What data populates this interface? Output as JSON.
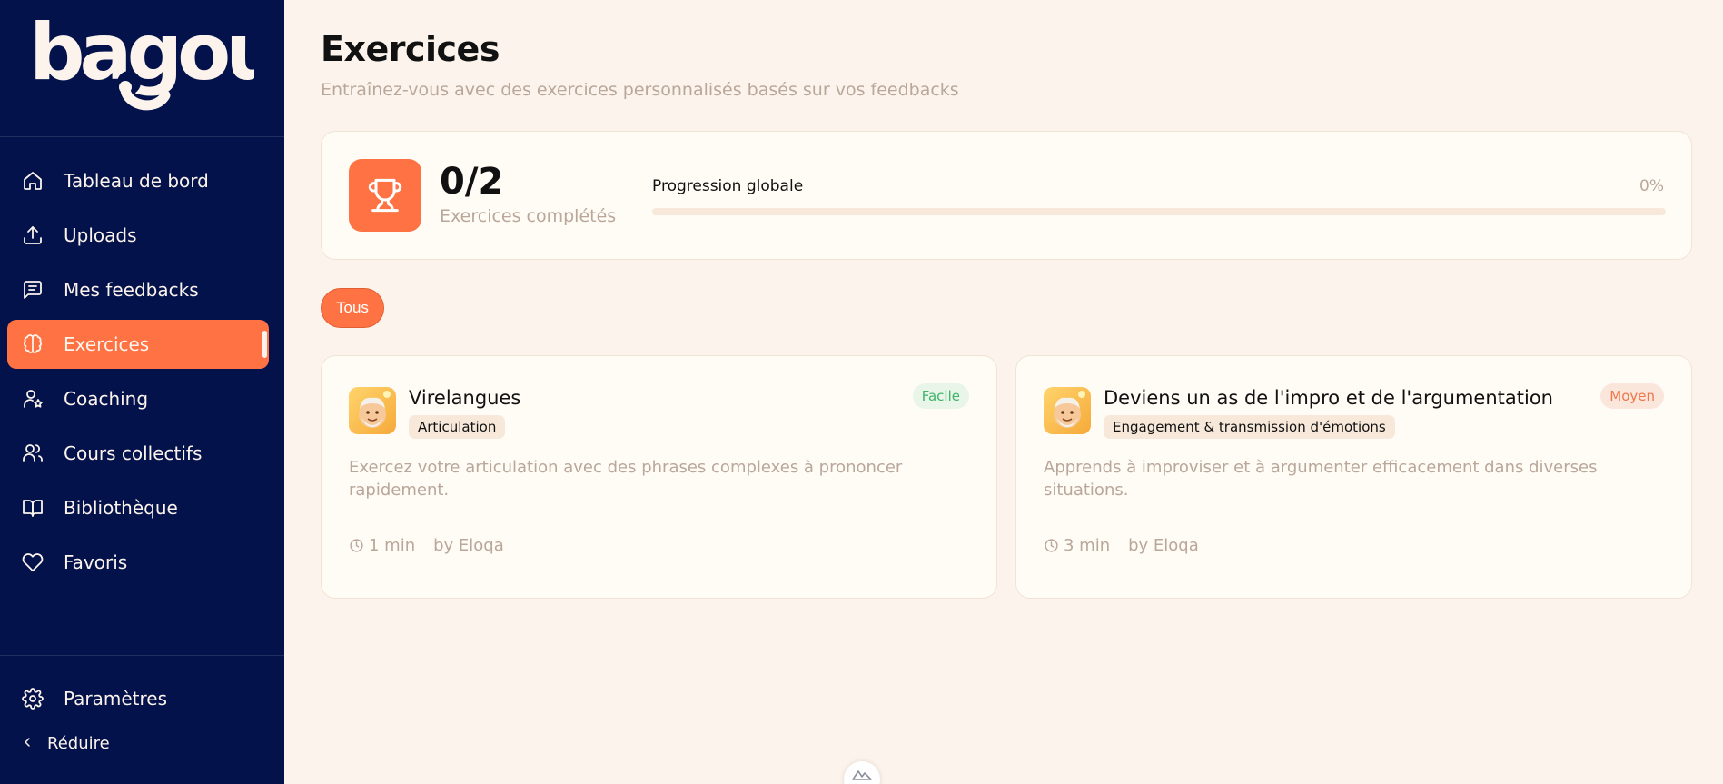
{
  "brand": {
    "logo_text": "bagou"
  },
  "sidebar": {
    "items": [
      {
        "label": "Tableau de bord",
        "icon": "home-icon"
      },
      {
        "label": "Uploads",
        "icon": "upload-icon"
      },
      {
        "label": "Mes feedbacks",
        "icon": "message-square-icon"
      },
      {
        "label": "Exercices",
        "icon": "brain-icon",
        "active": true
      },
      {
        "label": "Coaching",
        "icon": "user-star-icon"
      },
      {
        "label": "Cours collectifs",
        "icon": "users-icon"
      },
      {
        "label": "Bibliothèque",
        "icon": "book-open-icon"
      },
      {
        "label": "Favoris",
        "icon": "heart-icon"
      }
    ],
    "settings_label": "Paramètres",
    "collapse_label": "Réduire"
  },
  "page": {
    "title": "Exercices",
    "subtitle": "Entraînez-vous avec des exercices personnalisés basés sur vos feedbacks"
  },
  "stats": {
    "count": "0/2",
    "count_label": "Exercices complétés",
    "progress_label": "Progression globale",
    "progress_value": "0%",
    "progress_fraction": 0
  },
  "filters": {
    "active": "Tous"
  },
  "exercises": [
    {
      "title": "Virelangues",
      "category": "Articulation",
      "difficulty": "Facile",
      "description": "Exercez votre articulation avec des phrases complexes à prononcer rapidement.",
      "duration": "1 min",
      "author": "by Eloqa"
    },
    {
      "title": "Deviens un as de l'impro et de l'argumentation",
      "category": "Engagement & transmission d'émotions",
      "difficulty": "Moyen",
      "description": "Apprends à improviser et à argumenter efficacement dans diverses situations.",
      "duration": "3 min",
      "author": "by Eloqa"
    }
  ],
  "colors": {
    "sidebar_bg": "#03124A",
    "accent": "#FF7243",
    "page_bg": "#FCF4EC",
    "muted_text": "#B9A79A",
    "easy": "#3EB46A",
    "medium": "#F0764A"
  }
}
